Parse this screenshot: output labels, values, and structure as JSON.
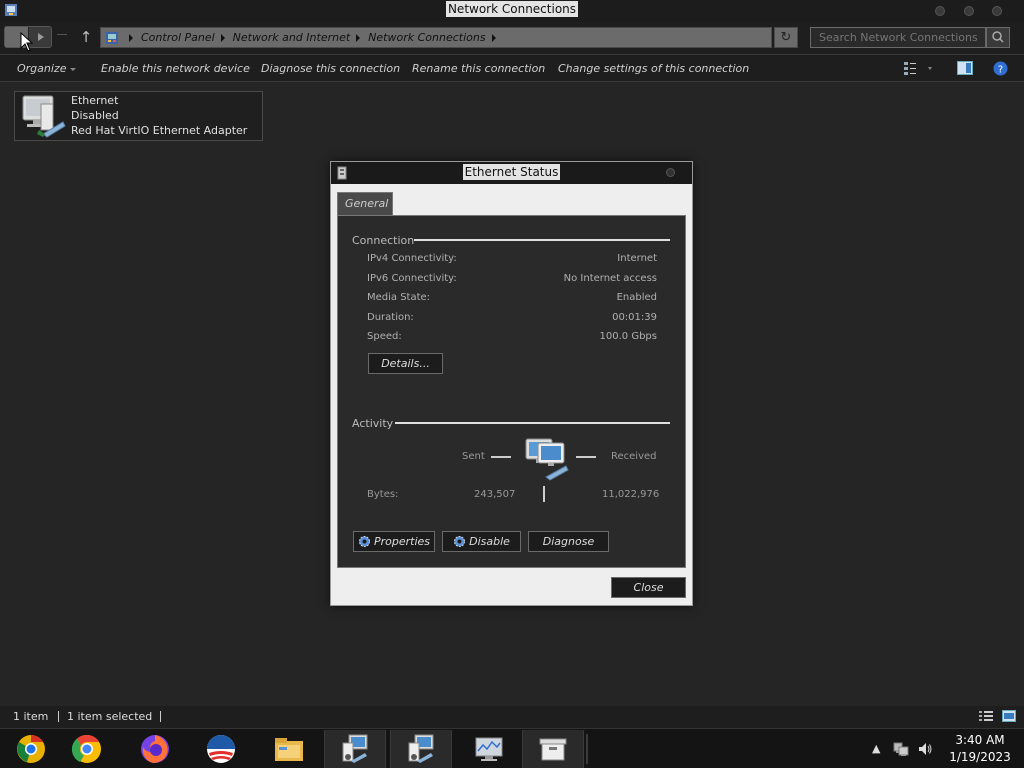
{
  "window": {
    "title": "Network Connections"
  },
  "address": {
    "breadcrumb": [
      "Control Panel",
      "Network and Internet",
      "Network Connections"
    ],
    "search_placeholder": "Search Network Connections"
  },
  "commands": {
    "organize": "Organize",
    "enable": "Enable this network device",
    "diagnose": "Diagnose this connection",
    "rename": "Rename this connection",
    "change": "Change settings of this connection"
  },
  "item": {
    "name": "Ethernet",
    "status": "Disabled",
    "adapter": "Red Hat VirtIO Ethernet Adapter"
  },
  "dialog": {
    "title": "Ethernet Status",
    "tab": "General",
    "connection_label": "Connection",
    "rows": [
      {
        "label": "IPv4 Connectivity:",
        "value": "Internet"
      },
      {
        "label": "IPv6 Connectivity:",
        "value": "No Internet access"
      },
      {
        "label": "Media State:",
        "value": "Enabled"
      },
      {
        "label": "Duration:",
        "value": "00:01:39"
      },
      {
        "label": "Speed:",
        "value": "100.0 Gbps"
      }
    ],
    "details_button": "Details...",
    "activity_label": "Activity",
    "sent_label": "Sent",
    "received_label": "Received",
    "bytes_label": "Bytes:",
    "bytes_sent": "243,507",
    "bytes_received": "11,022,976",
    "properties_button": "Properties",
    "disable_button": "Disable",
    "diagnose_button": "Diagnose",
    "close_button": "Close"
  },
  "statusbar": {
    "count": "1 item",
    "selected": "1 item selected"
  },
  "taskbar": {
    "apps": [
      "chrome-canary-icon",
      "chrome-icon",
      "firefox-icon",
      "obama-logo-icon",
      "file-explorer-icon",
      "network-icon",
      "network-icon",
      "monitor-icon",
      "archive-icon"
    ]
  },
  "clock": {
    "time": "3:40 AM",
    "date": "1/19/2023"
  },
  "colors": {
    "background": "#252525",
    "dialog_bg": "#eeeeee",
    "panel_bg": "#2a2a2a"
  }
}
